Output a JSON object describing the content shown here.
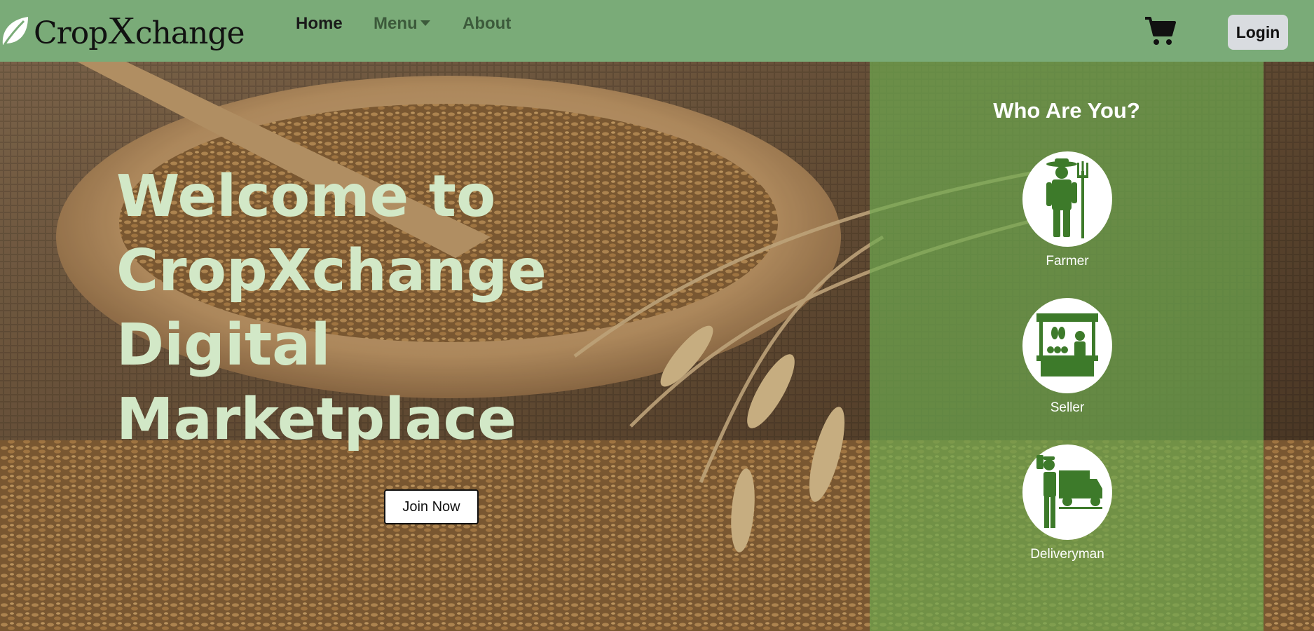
{
  "brand": {
    "name_part1": "Crop",
    "name_x": "X",
    "name_part2": "change",
    "icon": "leaf-icon"
  },
  "nav": {
    "home": "Home",
    "menu": "Menu",
    "about": "About"
  },
  "header": {
    "cart_icon": "shopping-cart-icon",
    "login_label": "Login"
  },
  "hero": {
    "headline": "Welcome to CropXchange Digital Marketplace",
    "join_label": "Join Now"
  },
  "roles": {
    "title": "Who Are You?",
    "items": [
      {
        "label": "Farmer",
        "icon": "farmer-icon"
      },
      {
        "label": "Seller",
        "icon": "market-stall-icon"
      },
      {
        "label": "Deliveryman",
        "icon": "delivery-truck-icon"
      }
    ]
  },
  "colors": {
    "navbar_bg": "#7aab78",
    "headline_text": "#d2e8c7",
    "panel_overlay": "#6eaa50",
    "icon_green": "#3d7a2a",
    "login_bg": "#d9dce0"
  }
}
